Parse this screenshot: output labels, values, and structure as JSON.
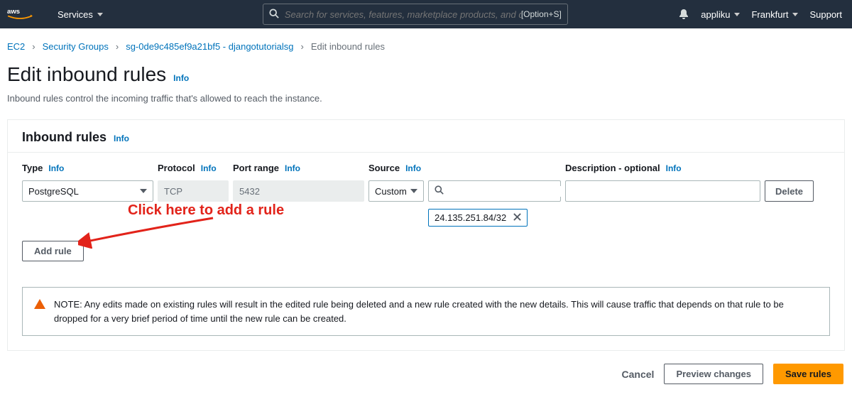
{
  "nav": {
    "services_label": "Services",
    "search_placeholder": "Search for services, features, marketplace products, and docs",
    "search_shortcut": "[Option+S]",
    "account": "appliku",
    "region": "Frankfurt",
    "support": "Support"
  },
  "breadcrumbs": {
    "items": [
      "EC2",
      "Security Groups",
      "sg-0de9c485ef9a21bf5 - djangotutorialsg"
    ],
    "current": "Edit inbound rules"
  },
  "header": {
    "title": "Edit inbound rules",
    "info": "Info",
    "description": "Inbound rules control the incoming traffic that's allowed to reach the instance."
  },
  "panel": {
    "title": "Inbound rules",
    "info": "Info",
    "columns": {
      "type": "Type",
      "protocol": "Protocol",
      "port_range": "Port range",
      "source": "Source",
      "description": "Description - optional"
    },
    "col_info": "Info",
    "rule": {
      "type_value": "PostgreSQL",
      "protocol_value": "TCP",
      "port_value": "5432",
      "source_mode": "Custom",
      "source_cidr": "24.135.251.84/32",
      "description_value": ""
    },
    "delete_label": "Delete",
    "add_rule_label": "Add rule",
    "note": "NOTE: Any edits made on existing rules will result in the edited rule being deleted and a new rule created with the new details. This will cause traffic that depends on that rule to be dropped for a very brief period of time until the new rule can be created."
  },
  "footer": {
    "cancel": "Cancel",
    "preview": "Preview changes",
    "save": "Save rules"
  },
  "annotation": {
    "text": "Click here to add a rule"
  }
}
